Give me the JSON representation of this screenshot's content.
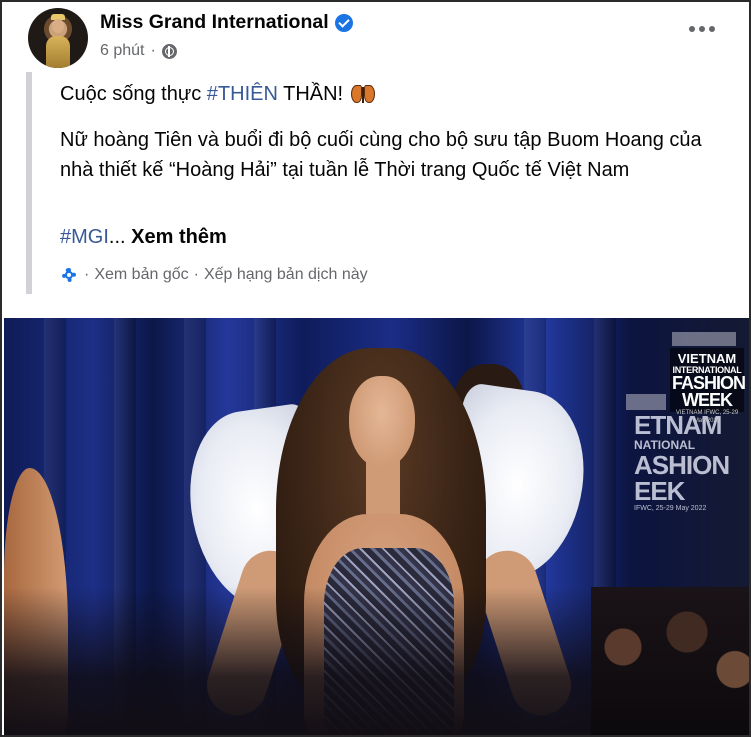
{
  "post": {
    "page_name": "Miss Grand International",
    "timestamp": "6 phút",
    "meta_separator": "·",
    "privacy_icon": "globe-icon",
    "verified_icon": "verified-badge-icon",
    "more_icon": "more-options-icon"
  },
  "content": {
    "line1_prefix": "Cuộc sống thực ",
    "line1_hashtag": "#THIÊN",
    "line1_suffix": " THẦN!",
    "emoji": "butterfly-emoji",
    "paragraph": "Nữ hoàng Tiên và buổi đi bộ cuối cùng cho bộ sưu tập Buom Hoang của nhà thiết kế “Hoàng Hải” tại tuần lễ Thời trang Quốc tế Việt Nam",
    "hashtag": "#MGI",
    "ellipsis": "...",
    "see_more": "Xem thêm"
  },
  "translation": {
    "gear_icon": "gear-icon",
    "view_original": "Xem bản gốc",
    "separator": "·",
    "rate_translation": "Xếp hạng bản dịch này"
  },
  "media": {
    "logo_line1": "VIETNAM",
    "logo_line2": "INTERNATIONAL",
    "logo_line3": "FASHION",
    "logo_line4": "WEEK",
    "logo_date": "VIETNAM IFWC, 25-29 May 2022",
    "backdrop_line1": "ETNAM",
    "backdrop_line2": "NATIONAL",
    "backdrop_line3": "ASHION",
    "backdrop_line4": "EEK",
    "backdrop_date": "IFWC, 25-29 May 2022"
  },
  "colors": {
    "link": "#385898",
    "secondary_text": "#65676b",
    "verified": "#1b74e4",
    "translation_bar": "#d0d2d6"
  }
}
